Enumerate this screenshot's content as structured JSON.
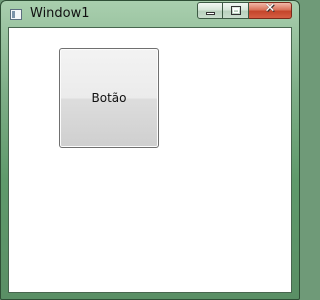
{
  "window": {
    "title": "Window1"
  },
  "caption": {
    "minimize_icon": "minimize-icon",
    "maximize_icon": "maximize-icon",
    "close_glyph": "✕"
  },
  "content": {
    "button_label": "Botão"
  },
  "colors": {
    "frame": "#6f9a78",
    "close_button": "#c5452b",
    "client_background": "#ffffff"
  }
}
